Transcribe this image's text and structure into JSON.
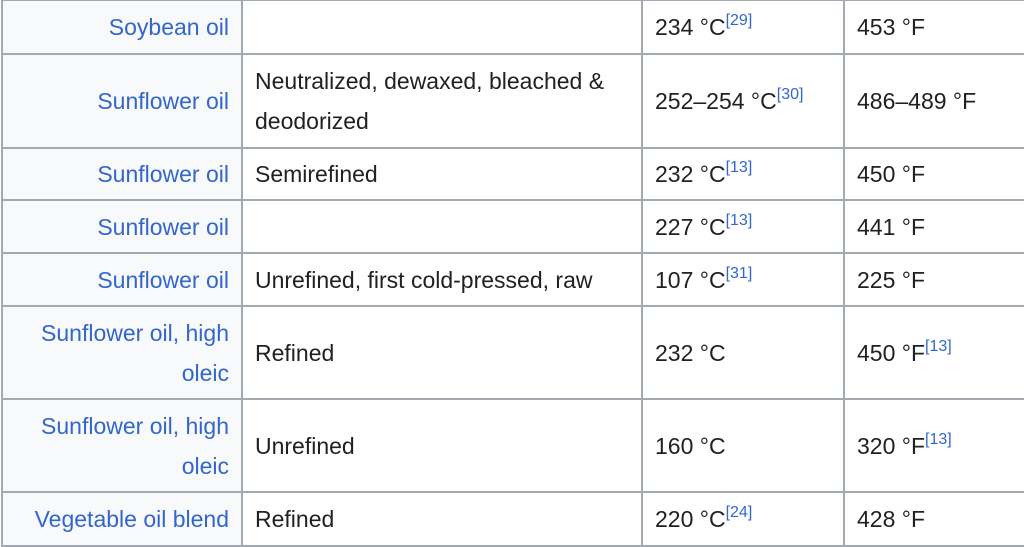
{
  "colors": {
    "link": "#3366cc",
    "border": "#a2a9b1",
    "header_bg": "#f8f9fa"
  },
  "rows": [
    {
      "name": "Soybean oil",
      "quality": "",
      "c": "234 °C",
      "c_ref": "[29]",
      "f": "453 °F",
      "f_ref": ""
    },
    {
      "name": "Sunflower oil",
      "quality": "Neutralized, dewaxed, bleached & deodorized",
      "c": "252–254 °C",
      "c_ref": "[30]",
      "f": "486–489 °F",
      "f_ref": ""
    },
    {
      "name": "Sunflower oil",
      "quality": "Semirefined",
      "c": "232 °C",
      "c_ref": "[13]",
      "f": "450 °F",
      "f_ref": ""
    },
    {
      "name": "Sunflower oil",
      "quality": "",
      "c": "227 °C",
      "c_ref": "[13]",
      "f": "441 °F",
      "f_ref": ""
    },
    {
      "name": "Sunflower oil",
      "quality": "Unrefined, first cold-pressed, raw",
      "c": "107 °C",
      "c_ref": "[31]",
      "f": "225 °F",
      "f_ref": ""
    },
    {
      "name": "Sunflower oil, high oleic",
      "quality": "Refined",
      "c": "232 °C",
      "c_ref": "",
      "f": "450 °F",
      "f_ref": "[13]"
    },
    {
      "name": "Sunflower oil, high oleic",
      "quality": "Unrefined",
      "c": "160 °C",
      "c_ref": "",
      "f": "320 °F",
      "f_ref": "[13]"
    },
    {
      "name": "Vegetable oil blend",
      "quality": "Refined",
      "c": "220 °C",
      "c_ref": "[24]",
      "f": "428 °F",
      "f_ref": ""
    }
  ]
}
